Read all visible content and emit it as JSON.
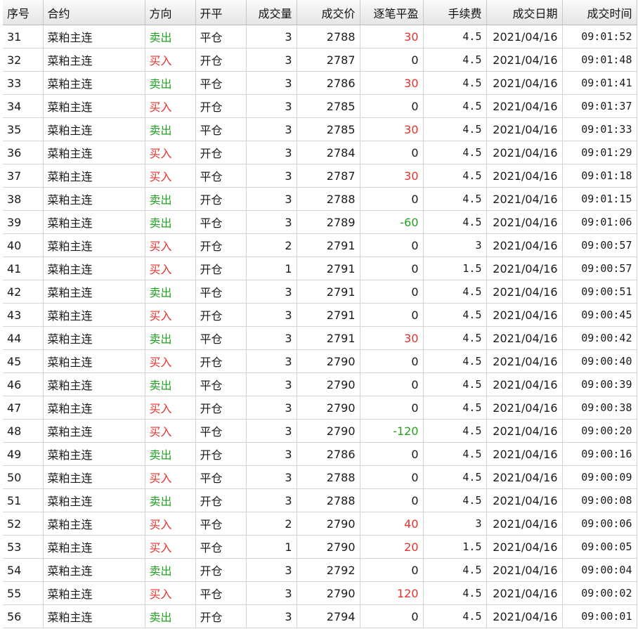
{
  "colors": {
    "buy": "#e5322d",
    "sell": "#22a022",
    "profit": "#e5322d",
    "loss": "#22a022"
  },
  "table": {
    "headers": [
      "序号",
      "合约",
      "方向",
      "开平",
      "成交量",
      "成交价",
      "逐笔平盈",
      "手续费",
      "成交日期",
      "成交时间"
    ],
    "rows": [
      [
        "31",
        "菜粕主连",
        "卖出",
        "平仓",
        "3",
        "2788",
        "30",
        "4.5",
        "2021/04/16",
        "09:01:52"
      ],
      [
        "32",
        "菜粕主连",
        "买入",
        "开仓",
        "3",
        "2787",
        "0",
        "4.5",
        "2021/04/16",
        "09:01:48"
      ],
      [
        "33",
        "菜粕主连",
        "卖出",
        "平仓",
        "3",
        "2786",
        "30",
        "4.5",
        "2021/04/16",
        "09:01:41"
      ],
      [
        "34",
        "菜粕主连",
        "买入",
        "开仓",
        "3",
        "2785",
        "0",
        "4.5",
        "2021/04/16",
        "09:01:37"
      ],
      [
        "35",
        "菜粕主连",
        "卖出",
        "平仓",
        "3",
        "2785",
        "30",
        "4.5",
        "2021/04/16",
        "09:01:33"
      ],
      [
        "36",
        "菜粕主连",
        "买入",
        "开仓",
        "3",
        "2784",
        "0",
        "4.5",
        "2021/04/16",
        "09:01:29"
      ],
      [
        "37",
        "菜粕主连",
        "买入",
        "平仓",
        "3",
        "2787",
        "30",
        "4.5",
        "2021/04/16",
        "09:01:18"
      ],
      [
        "38",
        "菜粕主连",
        "卖出",
        "开仓",
        "3",
        "2788",
        "0",
        "4.5",
        "2021/04/16",
        "09:01:15"
      ],
      [
        "39",
        "菜粕主连",
        "卖出",
        "平仓",
        "3",
        "2789",
        "-60",
        "4.5",
        "2021/04/16",
        "09:01:06"
      ],
      [
        "40",
        "菜粕主连",
        "买入",
        "开仓",
        "2",
        "2791",
        "0",
        "3",
        "2021/04/16",
        "09:00:57"
      ],
      [
        "41",
        "菜粕主连",
        "买入",
        "开仓",
        "1",
        "2791",
        "0",
        "1.5",
        "2021/04/16",
        "09:00:57"
      ],
      [
        "42",
        "菜粕主连",
        "卖出",
        "平仓",
        "3",
        "2791",
        "0",
        "4.5",
        "2021/04/16",
        "09:00:51"
      ],
      [
        "43",
        "菜粕主连",
        "买入",
        "开仓",
        "3",
        "2791",
        "0",
        "4.5",
        "2021/04/16",
        "09:00:45"
      ],
      [
        "44",
        "菜粕主连",
        "卖出",
        "平仓",
        "3",
        "2791",
        "30",
        "4.5",
        "2021/04/16",
        "09:00:42"
      ],
      [
        "45",
        "菜粕主连",
        "买入",
        "开仓",
        "3",
        "2790",
        "0",
        "4.5",
        "2021/04/16",
        "09:00:40"
      ],
      [
        "46",
        "菜粕主连",
        "卖出",
        "平仓",
        "3",
        "2790",
        "0",
        "4.5",
        "2021/04/16",
        "09:00:39"
      ],
      [
        "47",
        "菜粕主连",
        "买入",
        "开仓",
        "3",
        "2790",
        "0",
        "4.5",
        "2021/04/16",
        "09:00:38"
      ],
      [
        "48",
        "菜粕主连",
        "买入",
        "平仓",
        "3",
        "2790",
        "-120",
        "4.5",
        "2021/04/16",
        "09:00:20"
      ],
      [
        "49",
        "菜粕主连",
        "卖出",
        "开仓",
        "3",
        "2786",
        "0",
        "4.5",
        "2021/04/16",
        "09:00:16"
      ],
      [
        "50",
        "菜粕主连",
        "买入",
        "平仓",
        "3",
        "2788",
        "0",
        "4.5",
        "2021/04/16",
        "09:00:09"
      ],
      [
        "51",
        "菜粕主连",
        "卖出",
        "开仓",
        "3",
        "2788",
        "0",
        "4.5",
        "2021/04/16",
        "09:00:08"
      ],
      [
        "52",
        "菜粕主连",
        "买入",
        "平仓",
        "2",
        "2790",
        "40",
        "3",
        "2021/04/16",
        "09:00:06"
      ],
      [
        "53",
        "菜粕主连",
        "买入",
        "平仓",
        "1",
        "2790",
        "20",
        "1.5",
        "2021/04/16",
        "09:00:05"
      ],
      [
        "54",
        "菜粕主连",
        "卖出",
        "开仓",
        "3",
        "2792",
        "0",
        "4.5",
        "2021/04/16",
        "09:00:04"
      ],
      [
        "55",
        "菜粕主连",
        "买入",
        "平仓",
        "3",
        "2790",
        "120",
        "4.5",
        "2021/04/16",
        "09:00:02"
      ],
      [
        "56",
        "菜粕主连",
        "卖出",
        "开仓",
        "3",
        "2794",
        "0",
        "4.5",
        "2021/04/16",
        "09:00:01"
      ]
    ]
  }
}
